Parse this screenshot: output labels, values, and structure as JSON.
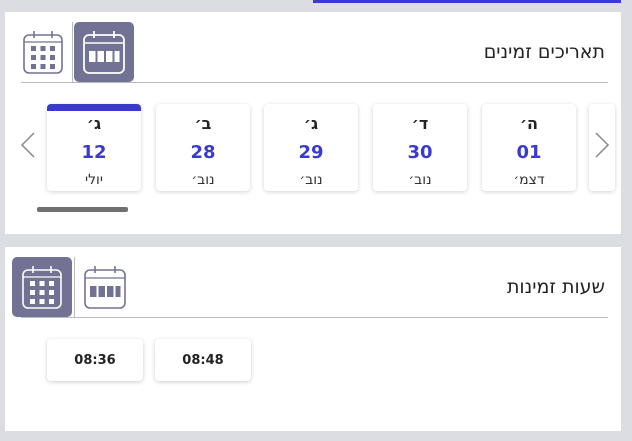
{
  "colors": {
    "accent": "#3a3ad1",
    "active_icon_bg": "#727394",
    "page_bg": "#dcdde3"
  },
  "dates_panel": {
    "title": "תאריכים זמינים",
    "view_icons": [
      "calendar-grid-icon",
      "calendar-week-icon"
    ],
    "active_view": "calendar-week-icon",
    "cards": [
      {
        "day": "ג׳",
        "date": "12",
        "month": "יולי",
        "selected": true
      },
      {
        "day": "ב׳",
        "date": "28",
        "month": "נוב׳",
        "selected": false
      },
      {
        "day": "ג׳",
        "date": "29",
        "month": "נוב׳",
        "selected": false
      },
      {
        "day": "ד׳",
        "date": "30",
        "month": "נוב׳",
        "selected": false
      },
      {
        "day": "ה׳",
        "date": "01",
        "month": "דצמ׳",
        "selected": false
      }
    ]
  },
  "times_panel": {
    "title": "שעות זמינות",
    "view_icons": [
      "calendar-grid-icon",
      "calendar-week-icon"
    ],
    "active_view": "calendar-grid-icon",
    "slots": [
      "08:36",
      "08:48"
    ]
  }
}
